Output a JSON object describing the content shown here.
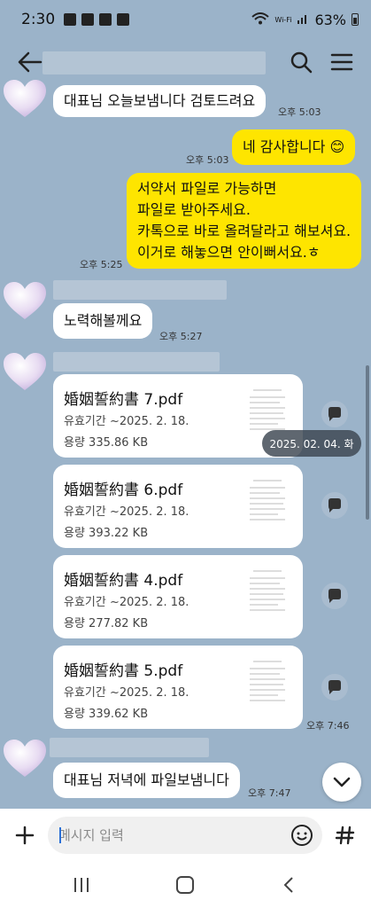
{
  "status": {
    "time": "2:30",
    "carrier": "Wi-Fi",
    "battery": "63%"
  },
  "header": {
    "title": ""
  },
  "messages": [
    {
      "type": "text",
      "text": "대표님 오늘보냄니다  검토드려요",
      "time": "오후 5:03"
    },
    {
      "type": "text",
      "text": "네 감사합니다 😊",
      "time": "오후 5:03"
    },
    {
      "type": "text",
      "lines": [
        "서약서 파일로 가능하면",
        "파일로 받아주세요.",
        "카톡으로 바로 올려달라고 해보셔요.",
        "이거로 해놓으면 안이뻐서요.ㅎ"
      ],
      "time": "오후 5:25"
    },
    {
      "type": "text",
      "text": "노력해볼께요",
      "time": "오후 5:27"
    },
    {
      "type": "file",
      "name": "婚姻誓約書 7.pdf",
      "expiry": "유효기간 ~2025. 2. 18.",
      "size": "용량  335.86 KB"
    },
    {
      "type": "file",
      "name": "婚姻誓約書 6.pdf",
      "expiry": "유효기간 ~2025. 2. 18.",
      "size": "용량  393.22 KB"
    },
    {
      "type": "file",
      "name": "婚姻誓約書 4.pdf",
      "expiry": "유효기간 ~2025. 2. 18.",
      "size": "용량  277.82 KB"
    },
    {
      "type": "file",
      "name": "婚姻誓約書 5.pdf",
      "expiry": "유효기간 ~2025. 2. 18.",
      "size": "용량  339.62 KB",
      "time": "오후 7:46"
    },
    {
      "type": "text",
      "text": "대표님 저녁에 파일보냄니다",
      "time": "오후 7:47"
    }
  ],
  "date_pill": "2025. 02. 04. 화",
  "input": {
    "placeholder": "메시지 입력"
  },
  "colors": {
    "background": "#9bb3c9",
    "my_bubble": "#fee500",
    "their_bubble": "#ffffff"
  }
}
